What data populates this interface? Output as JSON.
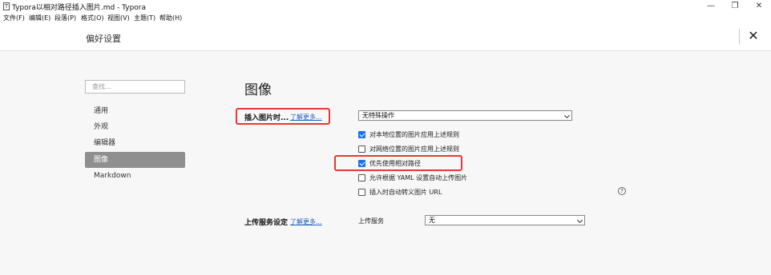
{
  "window": {
    "app_icon": "T",
    "title": "Typora以相对路径插入图片.md - Typora",
    "controls": {
      "minimize": "—",
      "maximize": "❐",
      "close": "✕"
    }
  },
  "menu": [
    "文件(F)",
    "编辑(E)",
    "段落(P)",
    "格式(O)",
    "视图(V)",
    "主题(T)",
    "帮助(H)"
  ],
  "header": {
    "title": "偏好设置",
    "close": "✕"
  },
  "sidebar": {
    "search_placeholder": "查找...",
    "items": [
      {
        "label": "通用",
        "active": false
      },
      {
        "label": "外观",
        "active": false
      },
      {
        "label": "编辑器",
        "active": false
      },
      {
        "label": "图像",
        "active": true
      },
      {
        "label": "Markdown",
        "active": false
      }
    ]
  },
  "main": {
    "section_title": "图像",
    "insert_image": {
      "label": "插入图片时...",
      "learn_more": "了解更多...",
      "select_value": "无特殊操作"
    },
    "options": [
      {
        "label": "对本地位置的图片应用上述规则",
        "checked": true
      },
      {
        "label": "对网络位置的图片应用上述规则",
        "checked": false
      },
      {
        "label": "优先使用相对路径",
        "checked": true
      },
      {
        "label": "允许根据 YAML 设置自动上传图片",
        "checked": false
      },
      {
        "label": "插入时自动转义图片 URL",
        "checked": false
      }
    ],
    "help_icon": "?",
    "upload": {
      "label": "上传服务设定",
      "learn_more": "了解更多...",
      "service_label": "上传服务",
      "service_value": "无"
    }
  },
  "colors": {
    "accent": "#1a73e8",
    "highlight": "#e53935",
    "active_nav": "#8f8f8f"
  }
}
